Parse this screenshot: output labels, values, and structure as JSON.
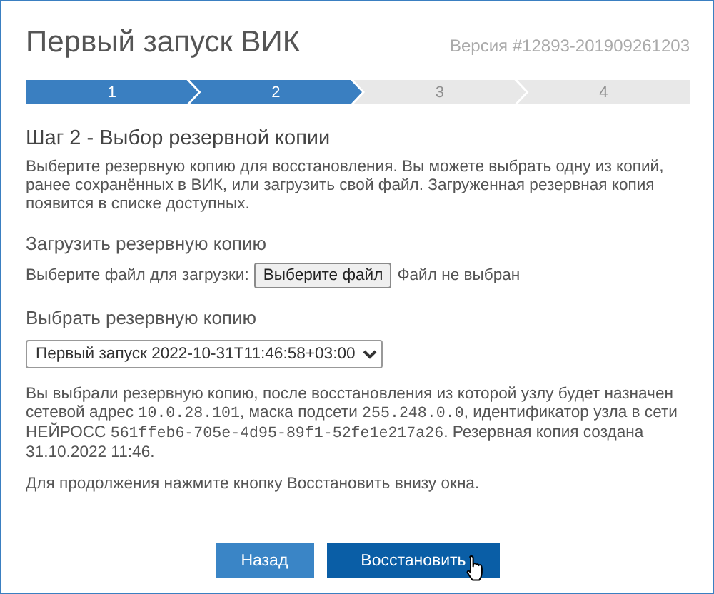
{
  "window": {
    "title": "Первый запуск ВИК",
    "version": "Версия #12893-201909261203"
  },
  "steps": [
    {
      "label": "1",
      "active": true
    },
    {
      "label": "2",
      "active": true
    },
    {
      "label": "3",
      "active": false
    },
    {
      "label": "4",
      "active": false
    }
  ],
  "step_title": "Шаг 2 - Выбор резервной копии",
  "intro": "Выберите резервную копию для восстановления. Вы можете выбрать одну из копий, ранее сохранённых в ВИК, или загрузить свой файл. Загруженная резервная копия появится в списке доступных.",
  "upload": {
    "heading": "Загрузить резервную копию",
    "label": "Выберите файл для загрузки:",
    "button": "Выберите файл",
    "status": "Файл не выбран"
  },
  "select": {
    "heading": "Выбрать резервную копию",
    "value": "Первый запуск 2022-10-31T11:46:58+03:00"
  },
  "info": [
    {
      "text": "Вы выбрали резервную копию, после восстановления из которой узлу будет назначен сетевой адрес ",
      "mono": false
    },
    {
      "text": "10.0.28.101",
      "mono": true
    },
    {
      "text": ", маска подсети ",
      "mono": false
    },
    {
      "text": "255.248.0.0",
      "mono": true
    },
    {
      "text": ", идентификатор узла в сети НЕЙРОСС ",
      "mono": false
    },
    {
      "text": "561ffeb6-705e-4d95-89f1-52fe1e217a26",
      "mono": true
    },
    {
      "text": ". Резервная копия создана 31.10.2022 11:46.",
      "mono": false
    }
  ],
  "hint": "Для продолжения нажмите кнопку Восстановить внизу окна.",
  "buttons": [
    {
      "label": "Назад",
      "kind": "secondary"
    },
    {
      "label": "Восстановить",
      "kind": "primary"
    }
  ]
}
